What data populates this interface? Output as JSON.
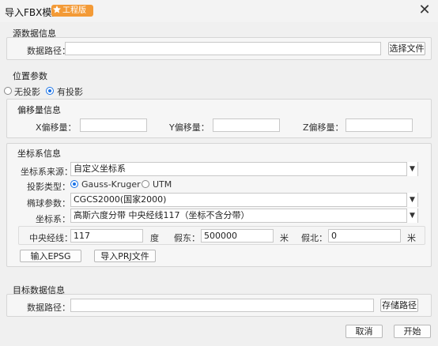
{
  "window": {
    "title": "导入FBX模型",
    "badge": "工程版",
    "close_icon": "close-icon"
  },
  "source": {
    "section_title": "源数据信息",
    "path_label": "数据路径：",
    "path_value": "",
    "choose_button": "选择文件"
  },
  "position": {
    "section_title": "位置参数",
    "no_projection": "无投影",
    "has_projection": "有投影",
    "selected": "有投影"
  },
  "offset": {
    "section_title": "偏移量信息",
    "x_label": "X偏移量：",
    "y_label": "Y偏移量：",
    "z_label": "Z偏移量：",
    "x_value": "",
    "y_value": "",
    "z_value": ""
  },
  "coordinate": {
    "section_title": "坐标系信息",
    "source_label": "坐标系来源：",
    "source_value": "自定义坐标系",
    "projection_type_label": "投影类型：",
    "gauss_kruger": "Gauss-Kruger",
    "utm": "UTM",
    "projection_selected": "Gauss-Kruger",
    "ellipsoid_label": "椭球参数：",
    "ellipsoid_value": "CGCS2000(国家2000)",
    "system_label": "坐标系：",
    "system_value": "高斯六度分带 中央经线117（坐标不含分带）",
    "central_meridian_label": "中央经线：",
    "central_meridian_value": "117",
    "degree_unit": "度",
    "false_east_label": "假东：",
    "false_east_value": "500000",
    "meter_unit_1": "米",
    "false_north_label": "假北：",
    "false_north_value": "0",
    "meter_unit_2": "米",
    "epsg_button": "输入EPSG",
    "prj_button": "导入PRJ文件"
  },
  "target": {
    "section_title": "目标数据信息",
    "path_label": "数据路径：",
    "path_value": "",
    "save_button": "存储路径"
  },
  "footer": {
    "cancel_button": "取消",
    "start_button": "开始"
  },
  "colors": {
    "badge": "#f39a36",
    "radio_accent": "#1a73e8"
  }
}
